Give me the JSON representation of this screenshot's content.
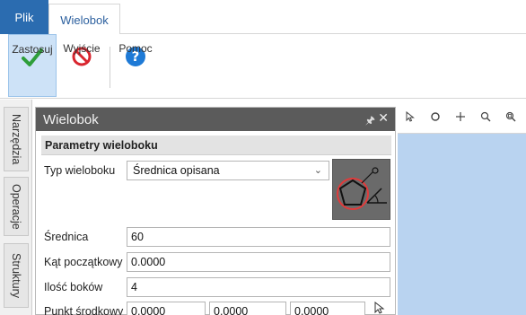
{
  "ribbon_tabs": {
    "file": "Plik",
    "active": "Wielobok"
  },
  "toolbar": {
    "apply": "Zastosuj",
    "exit": "Wyjście",
    "help": "Pomoc"
  },
  "side_tabs": [
    "Narzędzia",
    "Operacje",
    "Struktury"
  ],
  "panel": {
    "title": "Wielobok",
    "section": "Parametry wieloboku",
    "type_label": "Typ wieloboku",
    "type_value": "Średnica opisana",
    "diameter_label": "Średnica",
    "diameter_value": "60",
    "start_angle_label": "Kąt początkowy",
    "start_angle_value": "0.0000",
    "sides_label": "Ilość boków",
    "sides_value": "4",
    "center_label": "Punkt środkowy",
    "center_x": "0.0000",
    "center_y": "0.0000",
    "center_z": "0.0000"
  },
  "colors": {
    "file_tab": "#2b6cb0",
    "panel_header": "#5b5b5b",
    "viewport": "#b9d3f0",
    "apply_icon": "#2e9e3a",
    "exit_icon": "#d9262f",
    "help_icon": "#1e7ad6"
  }
}
